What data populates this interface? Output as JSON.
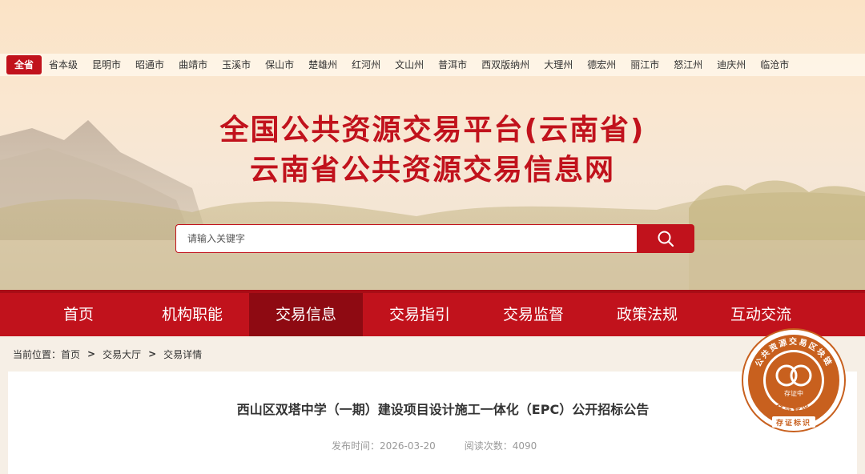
{
  "regions": [
    "全省",
    "省本级",
    "昆明市",
    "昭通市",
    "曲靖市",
    "玉溪市",
    "保山市",
    "楚雄州",
    "红河州",
    "文山州",
    "普洱市",
    "西双版纳州",
    "大理州",
    "德宏州",
    "丽江市",
    "怒江州",
    "迪庆州",
    "临沧市"
  ],
  "title": {
    "line1": "全国公共资源交易平台(云南省)",
    "line2": "云南省公共资源交易信息网"
  },
  "search": {
    "placeholder": "请输入关键字"
  },
  "nav": [
    "首页",
    "机构职能",
    "交易信息",
    "交易指引",
    "交易监督",
    "政策法规",
    "互动交流"
  ],
  "breadcrumb": {
    "prefix": "当前位置：",
    "items": [
      "首页",
      "交易大厅",
      "交易详情"
    ],
    "separator": ">"
  },
  "article": {
    "title": "西山区双塔中学（一期）建设项目设计施工一体化（EPC）公开招标公告",
    "publish_label": "发布时间：",
    "publish_date": "2026-03-20",
    "views_label": "阅读次数：",
    "views": "4090"
  },
  "seal": {
    "ring_text": "公共资源交易区块链",
    "center_label": "存证中",
    "bottom_text": "存证标识"
  },
  "colors": {
    "brand_red": "#c1121c",
    "nav_active": "#8e0a12",
    "seal_orange": "#c8601e"
  }
}
